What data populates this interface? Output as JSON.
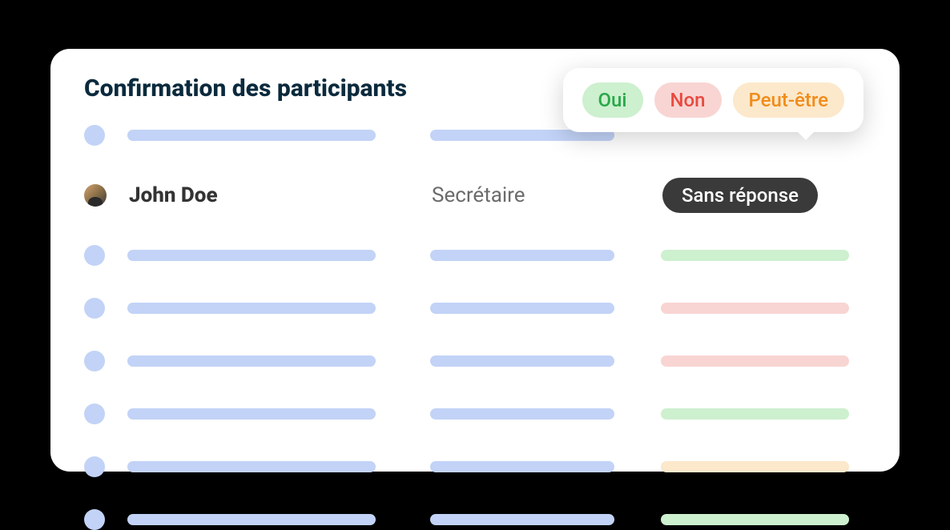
{
  "title": "Confirmation des participants",
  "participant": {
    "name": "John Doe",
    "role": "Secrétaire",
    "status_label": "Sans réponse"
  },
  "popover": {
    "yes": "Oui",
    "no": "Non",
    "maybe": "Peut-être"
  },
  "skeleton_rows": [
    {
      "status": "none"
    },
    {
      "status": "green"
    },
    {
      "status": "red"
    },
    {
      "status": "red"
    },
    {
      "status": "green"
    },
    {
      "status": "orange"
    },
    {
      "status": "green"
    }
  ],
  "colors": {
    "blue_skel": "#c2d3f7",
    "green": "#cdf0cf",
    "red": "#f8d5d3",
    "orange": "#fce8cb",
    "dark_badge": "#3a3a3a"
  }
}
